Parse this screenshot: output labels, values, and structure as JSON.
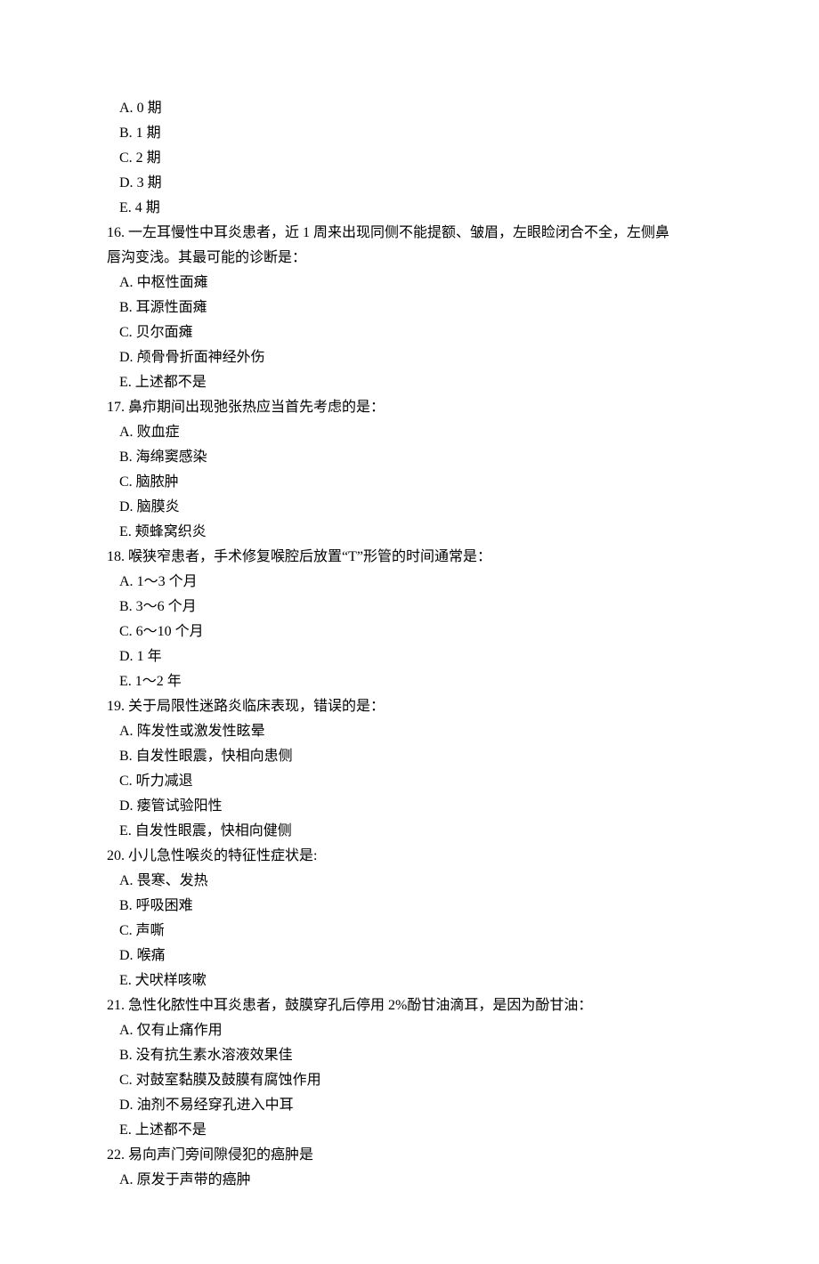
{
  "q15_options": [
    {
      "label": "A.",
      "text": "0 期"
    },
    {
      "label": "B.",
      "text": "1 期"
    },
    {
      "label": "C.",
      "text": "2 期"
    },
    {
      "label": "D.",
      "text": "3 期"
    },
    {
      "label": "E.",
      "text": "4 期"
    }
  ],
  "questions": [
    {
      "num": "16.",
      "stem_lines": [
        "一左耳慢性中耳炎患者，近 1 周来出现同侧不能提额、皱眉，左眼睑闭合不全，左侧鼻",
        "唇沟变浅。其最可能的诊断是："
      ],
      "options": [
        {
          "label": "A.",
          "text": "中枢性面瘫"
        },
        {
          "label": "B.",
          "text": "耳源性面瘫"
        },
        {
          "label": "C.",
          "text": "贝尔面瘫"
        },
        {
          "label": "D.",
          "text": "颅骨骨折面神经外伤"
        },
        {
          "label": "E.",
          "text": "上述都不是"
        }
      ]
    },
    {
      "num": "17.",
      "stem_lines": [
        "鼻疖期间出现弛张热应当首先考虑的是："
      ],
      "options": [
        {
          "label": "A.",
          "text": "败血症"
        },
        {
          "label": "B.",
          "text": "海绵窦感染"
        },
        {
          "label": "C.",
          "text": "脑脓肿"
        },
        {
          "label": "D.",
          "text": "脑膜炎"
        },
        {
          "label": "E.",
          "text": "颊蜂窝织炎"
        }
      ]
    },
    {
      "num": "18.",
      "stem_lines": [
        "喉狭窄患者，手术修复喉腔后放置“T”形管的时间通常是："
      ],
      "options": [
        {
          "label": "A.",
          "text": "1～3 个月"
        },
        {
          "label": "B.",
          "text": "3～6 个月"
        },
        {
          "label": "C.",
          "text": "6～10 个月"
        },
        {
          "label": "D.",
          "text": "1 年"
        },
        {
          "label": "E.",
          "text": "1～2 年"
        }
      ]
    },
    {
      "num": "19.",
      "stem_lines": [
        "关于局限性迷路炎临床表现，错误的是："
      ],
      "options": [
        {
          "label": "A.",
          "text": "阵发性或激发性眩晕"
        },
        {
          "label": "B.",
          "text": "自发性眼震，快相向患侧"
        },
        {
          "label": "C.",
          "text": "听力减退"
        },
        {
          "label": "D.",
          "text": "瘘管试验阳性"
        },
        {
          "label": "E.",
          "text": "自发性眼震，快相向健侧"
        }
      ]
    },
    {
      "num": "20.",
      "stem_lines": [
        "小儿急性喉炎的特征性症状是:"
      ],
      "options": [
        {
          "label": "A.",
          "text": "畏寒、发热"
        },
        {
          "label": "B.",
          "text": "呼吸困难"
        },
        {
          "label": "C.",
          "text": "声嘶"
        },
        {
          "label": "D.",
          "text": "喉痛"
        },
        {
          "label": "E.",
          "text": "犬吠样咳嗽"
        }
      ]
    },
    {
      "num": "21.",
      "stem_lines": [
        "急性化脓性中耳炎患者，鼓膜穿孔后停用 2%酚甘油滴耳，是因为酚甘油："
      ],
      "options": [
        {
          "label": "A.",
          "text": "仅有止痛作用"
        },
        {
          "label": "B.",
          "text": "没有抗生素水溶液效果佳"
        },
        {
          "label": "C.",
          "text": "对鼓室黏膜及鼓膜有腐蚀作用"
        },
        {
          "label": "D.",
          "text": "油剂不易经穿孔进入中耳"
        },
        {
          "label": "E.",
          "text": "上述都不是"
        }
      ]
    },
    {
      "num": "22.",
      "stem_lines": [
        "易向声门旁间隙侵犯的癌肿是"
      ],
      "options": [
        {
          "label": "A.",
          "text": "原发于声带的癌肿"
        }
      ]
    }
  ]
}
